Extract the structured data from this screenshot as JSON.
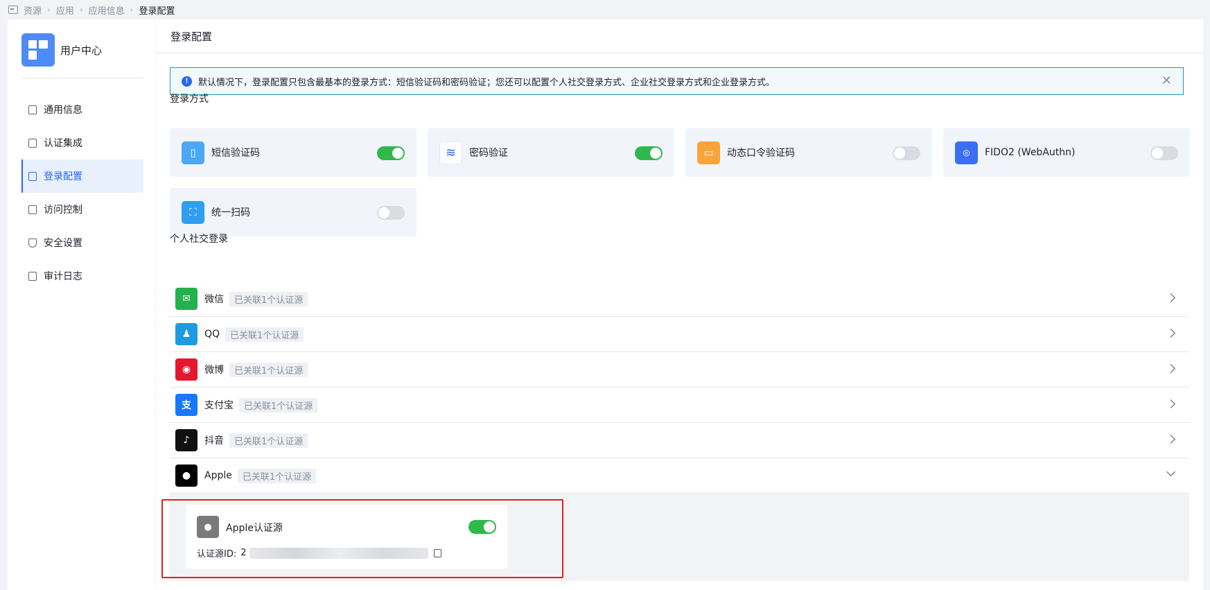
{
  "breadcrumb": {
    "items": [
      "资源",
      "应用",
      "应用信息"
    ],
    "current": "登录配置"
  },
  "sidebar": {
    "app_name": "用户中心",
    "items": [
      {
        "label": "通用信息",
        "active": false
      },
      {
        "label": "认证集成",
        "active": false
      },
      {
        "label": "登录配置",
        "active": true
      },
      {
        "label": "访问控制",
        "active": false
      },
      {
        "label": "安全设置",
        "active": false
      },
      {
        "label": "审计日志",
        "active": false
      }
    ]
  },
  "main": {
    "title": "登录配置",
    "alert": "默认情况下，登录配置只包含最基本的登录方式：短信验证码和密码验证；您还可以配置个人社交登录方式、企业社交登录方式和企业登录方式。",
    "login_methods_label": "登录方式",
    "login_methods": [
      {
        "name": "短信验证码",
        "enabled": true,
        "color": "#4aa8f5"
      },
      {
        "name": "密码验证",
        "enabled": true,
        "color": "#ffffff"
      },
      {
        "name": "动态口令验证码",
        "enabled": false,
        "color": "#f7a43b"
      },
      {
        "name": "FIDO2 (WebAuthn)",
        "enabled": false,
        "color": "#3b6ff2"
      },
      {
        "name": "统一扫码",
        "enabled": false,
        "color": "#2f9df0"
      }
    ],
    "social_label": "个人社交登录",
    "social": [
      {
        "name": "微信",
        "badge": "已关联1个认证源",
        "color": "#22b14c",
        "glyph": "✉",
        "expanded": false
      },
      {
        "name": "QQ",
        "badge": "已关联1个认证源",
        "color": "#1e9be0",
        "glyph": "♟",
        "expanded": false
      },
      {
        "name": "微博",
        "badge": "已关联1个认证源",
        "color": "#e6162d",
        "glyph": "◉",
        "expanded": false
      },
      {
        "name": "支付宝",
        "badge": "已关联1个认证源",
        "color": "#1677ff",
        "glyph": "支",
        "expanded": false
      },
      {
        "name": "抖音",
        "badge": "已关联1个认证源",
        "color": "#111111",
        "glyph": "♪",
        "expanded": false
      },
      {
        "name": "Apple",
        "badge": "已关联1个认证源",
        "color": "#000000",
        "glyph": "",
        "expanded": true
      }
    ],
    "source_card": {
      "title": "Apple认证源",
      "enabled": true,
      "id_label": "认证源ID:",
      "id_prefix": "2"
    }
  }
}
